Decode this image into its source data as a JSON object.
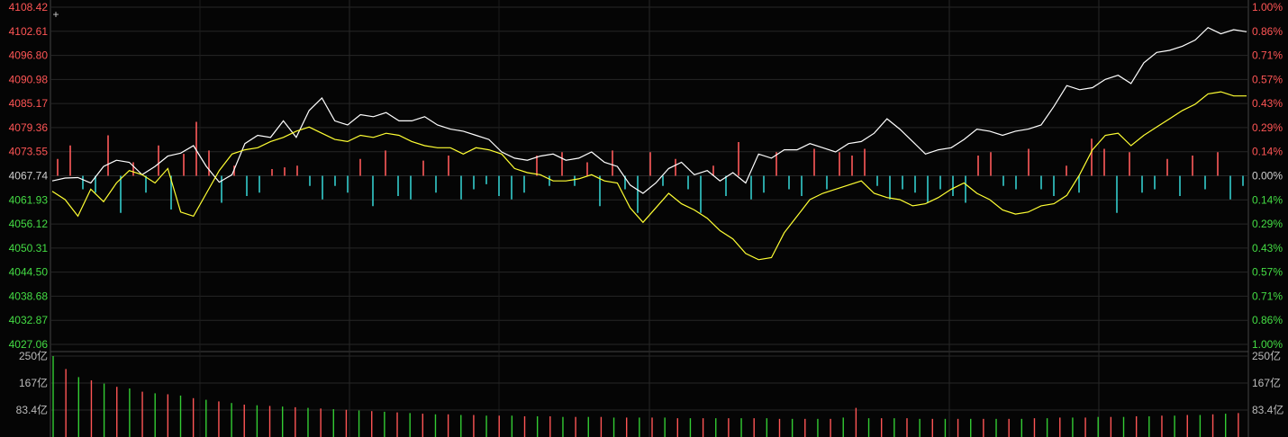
{
  "chart_data": [
    {
      "type": "line",
      "title": "",
      "y_left_ticks": [
        "4108.42",
        "4102.61",
        "4096.80",
        "4090.98",
        "4085.17",
        "4079.36",
        "4073.55",
        "4067.74",
        "4061.93",
        "4056.12",
        "4050.31",
        "4044.50",
        "4038.68",
        "4032.87",
        "4027.06"
      ],
      "y_right_ticks": [
        "1.00%",
        "0.86%",
        "0.71%",
        "0.57%",
        "0.43%",
        "0.29%",
        "0.14%",
        "0.00%",
        "0.14%",
        "0.29%",
        "0.43%",
        "0.57%",
        "0.71%",
        "0.86%",
        "1.00%"
      ],
      "ylim": [
        4027.06,
        4108.42
      ],
      "baseline": 4067.74,
      "series": [
        {
          "values": [
            4066.5,
            4067.2,
            4067.3,
            4066.0,
            4070.0,
            4071.5,
            4071.0,
            4068.0,
            4070.0,
            4072.5,
            4073.2,
            4075.0,
            4070.0,
            4066.2,
            4068.0,
            4075.5,
            4077.5,
            4077.0,
            4081.0,
            4077.0,
            4083.5,
            4086.5,
            4081.0,
            4080.0,
            4082.5,
            4082.0,
            4083.0,
            4081.0,
            4081.0,
            4082.0,
            4080.0,
            4079.0,
            4078.5,
            4077.5,
            4076.5,
            4073.5,
            4072.0,
            4071.5,
            4072.5,
            4073.0,
            4071.5,
            4072.0,
            4073.5,
            4071.0,
            4070.0,
            4065.5,
            4063.5,
            4066.0,
            4069.5,
            4071.0,
            4068.0,
            4069.0,
            4066.5,
            4068.5,
            4066.0,
            4073.0,
            4072.0,
            4074.0,
            4074.0,
            4075.5,
            4074.5,
            4073.5,
            4075.5,
            4076.0,
            4078.0,
            4081.5,
            4079.0,
            4076.0,
            4073.0,
            4074.0,
            4074.5,
            4076.5,
            4079.0,
            4078.5,
            4077.5,
            4078.5,
            4079.0,
            4080.0,
            4084.5,
            4089.5,
            4088.5,
            4089.0,
            4091.0,
            4092.0,
            4090.0,
            4095.0,
            4097.5,
            4098.0,
            4099.0,
            4100.5,
            4103.5,
            4102.0,
            4103.0,
            4102.5
          ],
          "color": "#ffffff"
        },
        {
          "values": [
            4064.0,
            4062.0,
            4058.0,
            4064.5,
            4061.5,
            4066.0,
            4069.0,
            4068.0,
            4066.0,
            4069.5,
            4059.0,
            4058.0,
            4063.5,
            4069.0,
            4073.0,
            4074.0,
            4074.5,
            4076.0,
            4077.0,
            4078.5,
            4079.5,
            4078.0,
            4076.5,
            4076.0,
            4077.5,
            4077.0,
            4078.0,
            4077.5,
            4076.0,
            4075.0,
            4074.5,
            4074.5,
            4073.0,
            4074.5,
            4074.0,
            4073.0,
            4069.5,
            4068.5,
            4068.0,
            4066.5,
            4066.5,
            4067.0,
            4068.0,
            4066.5,
            4066.0,
            4060.0,
            4056.5,
            4060.0,
            4063.5,
            4061.0,
            4059.5,
            4057.5,
            4054.5,
            4052.5,
            4049.0,
            4047.5,
            4048.0,
            4054.0,
            4058.0,
            4062.0,
            4063.5,
            4064.5,
            4065.5,
            4066.5,
            4063.5,
            4062.5,
            4062.0,
            4060.5,
            4061.0,
            4062.5,
            4064.5,
            4066.0,
            4063.5,
            4062.0,
            4059.5,
            4058.5,
            4059.0,
            4060.5,
            4061.0,
            4063.0,
            4068.0,
            4074.0,
            4077.5,
            4078.0,
            4075.0,
            4077.5,
            4079.5,
            4081.5,
            4083.5,
            4085.0,
            4087.5,
            4088.0,
            4087.0,
            4087.0
          ],
          "color": "#ffff33"
        }
      ],
      "breadth_bars": [
        10,
        18,
        -8,
        -10,
        24,
        -22,
        8,
        -10,
        18,
        -20,
        13,
        32,
        15,
        -16,
        6,
        -12,
        -10,
        4,
        5,
        6,
        -6,
        -14,
        -6,
        -10,
        10,
        -18,
        15,
        -12,
        -14,
        9,
        -10,
        12,
        -14,
        -8,
        -5,
        -12,
        -14,
        -10,
        12,
        -6,
        14,
        -6,
        8,
        -18,
        15,
        -8,
        -22,
        14,
        -6,
        10,
        -8,
        -22,
        6,
        -12,
        20,
        -14,
        -10,
        14,
        -8,
        -12,
        16,
        -8,
        14,
        12,
        16,
        -6,
        -14,
        -8,
        -10,
        -16,
        -8,
        -12,
        -16,
        12,
        14,
        -6,
        -8,
        16,
        -8,
        -12,
        6,
        -10,
        22,
        16,
        -22,
        14,
        -10,
        -8,
        10,
        -12,
        12,
        -8,
        14,
        -14,
        -6
      ],
      "breadth_unit": "percent of panel half-height"
    },
    {
      "type": "bar",
      "title": "",
      "y_ticks": [
        "250亿",
        "167亿",
        "83.4亿"
      ],
      "ylim": [
        0,
        250
      ],
      "values": [
        250,
        210,
        185,
        175,
        165,
        155,
        150,
        140,
        135,
        132,
        128,
        120,
        115,
        110,
        105,
        100,
        98,
        96,
        94,
        92,
        90,
        88,
        86,
        84,
        82,
        80,
        78,
        76,
        74,
        72,
        70,
        70,
        68,
        68,
        66,
        66,
        66,
        64,
        64,
        64,
        62,
        62,
        62,
        62,
        60,
        60,
        60,
        60,
        60,
        58,
        58,
        58,
        58,
        58,
        58,
        58,
        58,
        56,
        56,
        56,
        56,
        56,
        60,
        90,
        58,
        58,
        58,
        58,
        56,
        56,
        56,
        56,
        56,
        56,
        56,
        56,
        56,
        58,
        58,
        60,
        60,
        60,
        62,
        62,
        62,
        64,
        64,
        66,
        66,
        68,
        68,
        70,
        72,
        74
      ]
    }
  ]
}
